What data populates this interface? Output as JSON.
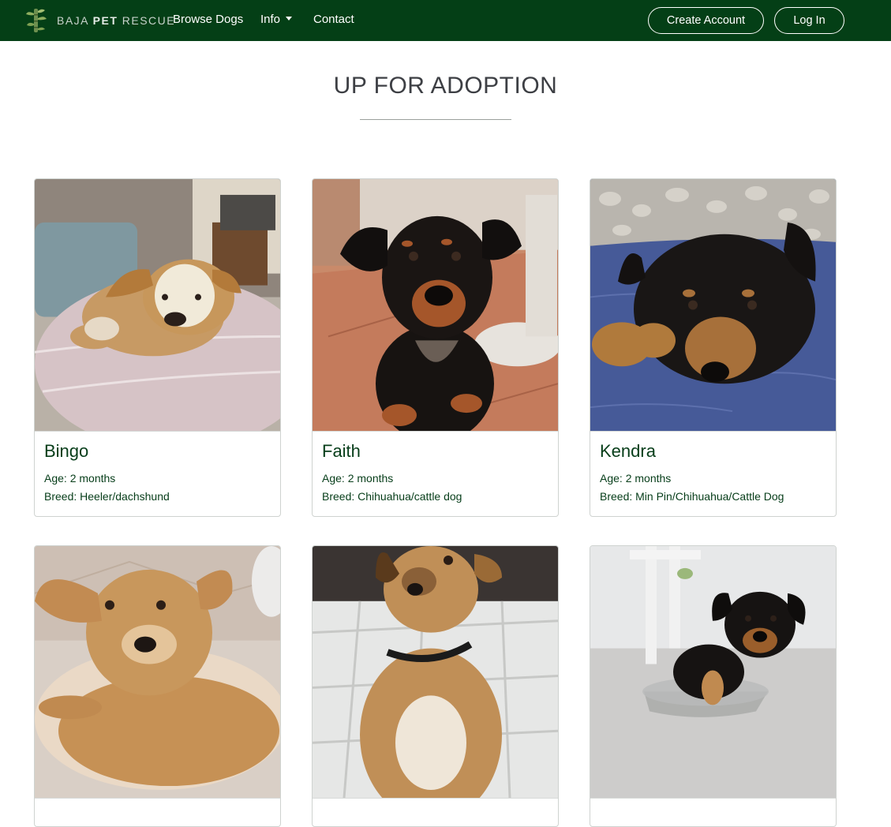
{
  "brand": {
    "part1": "BAJA",
    "part2": "PET",
    "part3": "RESCUE",
    "color": "#043f16"
  },
  "nav": {
    "browse": "Browse Dogs",
    "info": "Info",
    "contact": "Contact"
  },
  "auth": {
    "create_account": "Create Account",
    "login": "Log In"
  },
  "page": {
    "heading": "UP FOR ADOPTION"
  },
  "dogs": [
    {
      "name": "Bingo",
      "age": "Age: 2 months",
      "breed": "Breed: Heeler/dachshund"
    },
    {
      "name": "Faith",
      "age": "Age: 2 months",
      "breed": "Breed: Chihuahua/cattle dog"
    },
    {
      "name": "Kendra",
      "age": "Age: 2 months",
      "breed": "Breed: Min Pin/Chihuahua/Cattle Dog"
    },
    {
      "name": "",
      "age": "",
      "breed": ""
    },
    {
      "name": "",
      "age": "",
      "breed": ""
    },
    {
      "name": "",
      "age": "",
      "breed": ""
    }
  ],
  "colors": {
    "navbar_bg": "#043f16",
    "card_text": "#063d19",
    "heading_text": "#3d3f44"
  }
}
